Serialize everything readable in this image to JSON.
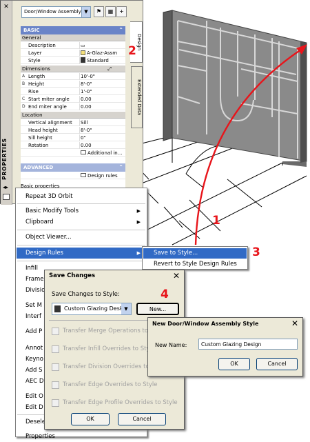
{
  "palette": {
    "title": "PROPERTIES",
    "close_glyph": "✕",
    "object_combo": "Door/Window Assembly",
    "tabs": [
      "Design",
      "Extended Data"
    ],
    "basic": {
      "label": "BASIC",
      "general_label": "General",
      "rows": [
        {
          "key": "Description",
          "value": ""
        },
        {
          "key": "Layer",
          "value": "A-Glaz-Assm"
        },
        {
          "key": "Style",
          "value": "Standard"
        }
      ],
      "dimensions_label": "Dimensions",
      "dims": [
        {
          "marker": "A",
          "key": "Length",
          "value": "10'-0\""
        },
        {
          "marker": "B",
          "key": "Height",
          "value": "8'-0\""
        },
        {
          "marker": "",
          "key": "Rise",
          "value": "1'-0\""
        },
        {
          "marker": "C",
          "key": "Start miter angle",
          "value": "0.00"
        },
        {
          "marker": "D",
          "key": "End miter angle",
          "value": "0.00"
        }
      ],
      "location_label": "Location",
      "loc": [
        {
          "key": "Vertical alignment",
          "value": "Sill"
        },
        {
          "key": "Head height",
          "value": "8'-0\""
        },
        {
          "key": "Sill height",
          "value": "0\""
        },
        {
          "key": "Rotation",
          "value": "0.00"
        },
        {
          "key": "",
          "value": "Additional in..."
        }
      ]
    },
    "advanced": {
      "label": "ADVANCED",
      "design_rules": "Design rules",
      "basic_props": "Basic properties"
    }
  },
  "context_menu": {
    "items": [
      "Repeat 3D Orbit",
      "Basic Modify Tools",
      "Clipboard",
      "Object Viewer...",
      "Design Rules",
      "Infill",
      "Frame",
      "Divisio",
      "Set M",
      "Interf",
      "Add P",
      "Annot",
      "Keyno",
      "Add S",
      "AEC D",
      "Edit O",
      "Edit D",
      "Deselect",
      "Properties"
    ]
  },
  "submenu": {
    "items": [
      "Save to Style...",
      "Revert to Style Design Rules"
    ]
  },
  "save_dialog": {
    "title": "Save Changes",
    "save_to_label": "Save Changes to Style:",
    "style_value": "Custom Glazing Desk",
    "new_button": "New...",
    "options": [
      "Transfer Merge Operations to Style",
      "Transfer Infill Overrides to Style",
      "Transfer Division Overrides to Style",
      "Transfer Edge Overrides to Style",
      "Transfer Edge Profile Overrides to Style"
    ],
    "ok": "OK",
    "cancel": "Cancel"
  },
  "new_style_dialog": {
    "title": "New Door/Window Assembly Style",
    "name_label": "New Name:",
    "name_value": "Custom Glazing Design",
    "ok": "OK",
    "cancel": "Cancel"
  },
  "callouts": [
    "1",
    "2",
    "3",
    "4"
  ],
  "colors": {
    "accent": "#e8151b",
    "highlight": "#316ac5",
    "section": "#6a84c8"
  }
}
